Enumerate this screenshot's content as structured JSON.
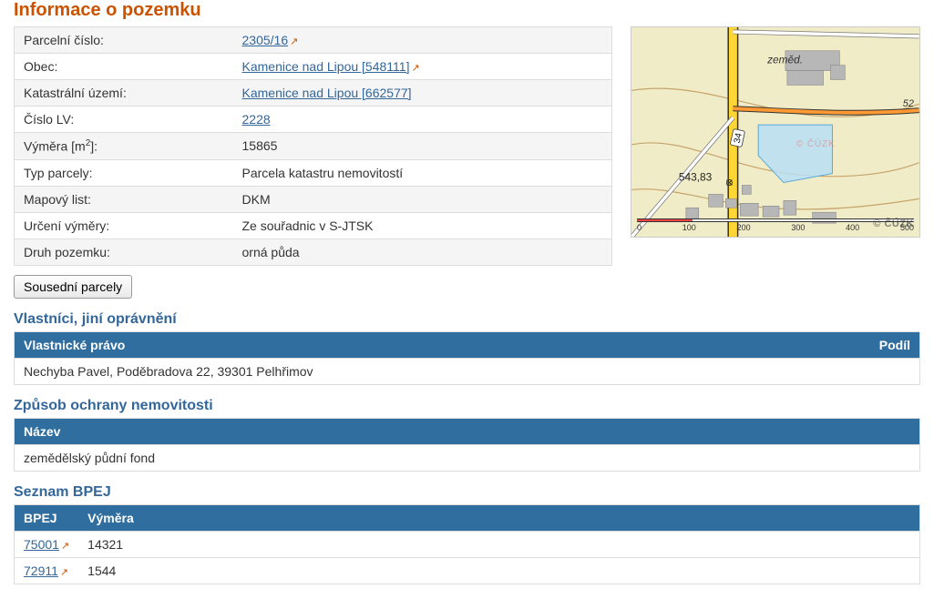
{
  "title": "Informace o pozemku",
  "summary": {
    "rows": [
      {
        "label": "Parcelní číslo:",
        "value": "2305/16",
        "link": true,
        "ext": true
      },
      {
        "label": "Obec:",
        "value": "Kamenice nad Lipou [548111]",
        "link": true,
        "ext": true
      },
      {
        "label": "Katastrální území:",
        "value": "Kamenice nad Lipou [662577]",
        "link": true,
        "ext": false
      },
      {
        "label": "Číslo LV:",
        "value": "2228",
        "link": true,
        "ext": false
      },
      {
        "label_html": "Výměra [m<sup>2</sup>]:",
        "value": "15865",
        "link": false
      },
      {
        "label": "Typ parcely:",
        "value": "Parcela katastru nemovitostí",
        "link": false
      },
      {
        "label": "Mapový list:",
        "value": "DKM",
        "link": false
      },
      {
        "label": "Určení výměry:",
        "value": "Ze souřadnic v S-JTSK",
        "link": false
      },
      {
        "label": "Druh pozemku:",
        "value": "orná půda",
        "link": false
      }
    ]
  },
  "neighbors_button": "Sousední parcely",
  "owners": {
    "title": "Vlastníci, jiní oprávnění",
    "headers": {
      "right": "Vlastnické právo",
      "share": "Podíl"
    },
    "rows": [
      {
        "text": "Nechyba Pavel, Poděbradova 22, 39301 Pelhřimov",
        "share": ""
      }
    ]
  },
  "protection": {
    "title": "Způsob ochrany nemovitosti",
    "headers": {
      "name": "Název"
    },
    "rows": [
      {
        "text": "zemědělský půdní fond"
      }
    ]
  },
  "bpej": {
    "title": "Seznam BPEJ",
    "headers": {
      "code": "BPEJ",
      "area": "Výměra"
    },
    "rows": [
      {
        "code": "75001",
        "area": "14321"
      },
      {
        "code": "72911",
        "area": "1544"
      }
    ]
  },
  "map": {
    "labels": {
      "zemed": "zeměd.",
      "spot": "543,83",
      "road": "34",
      "edge": "52"
    },
    "watermark": "© ČÚZK",
    "parcel_watermark": "© ČÚZK",
    "scalebar": [
      "0",
      "100",
      "200",
      "300",
      "400",
      "500"
    ]
  }
}
